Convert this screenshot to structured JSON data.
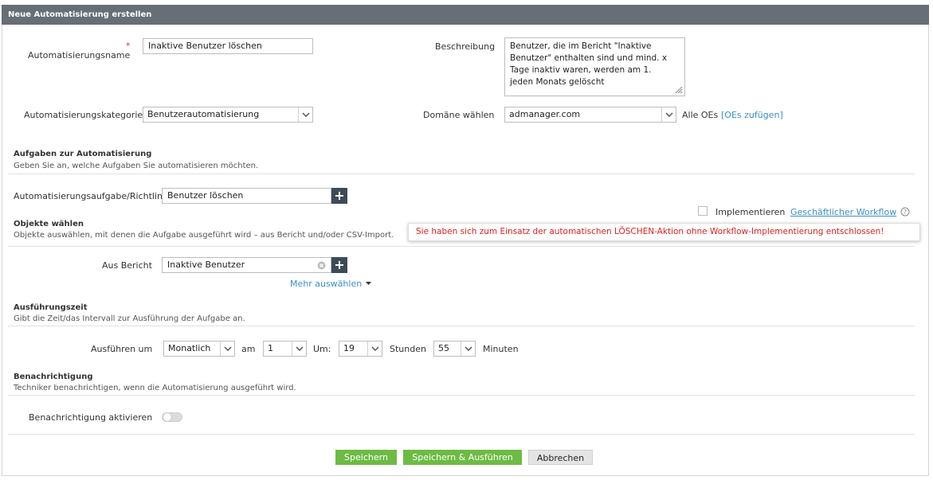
{
  "header": {
    "title": "Neue Automatisierung erstellen"
  },
  "general": {
    "name_label": "Automatisierungsname",
    "required_mark": "*",
    "name_value": "Inaktive Benutzer löschen",
    "description_label": "Beschreibung",
    "description_lines": [
      "Benutzer, die im Bericht \"Inaktive",
      "Benutzer\" enthalten sind und mind. x",
      "Tage inaktiv waren, werden am 1.",
      "jeden Monats gelöscht"
    ],
    "category_label": "Automatisierungskategorie",
    "category_value": "Benutzerautomatisierung",
    "domain_label": "Domäne wählen",
    "domain_value": "admanager.com",
    "all_ous": "Alle OEs",
    "add_ous_link": "[OEs zufügen]"
  },
  "tasks": {
    "title": "Aufgaben zur Automatisierung",
    "desc": "Geben Sie an, welche Aufgaben Sie automatisieren möchten.",
    "task_label": "Automatisierungsaufgabe/Richtlinie",
    "task_value": "Benutzer löschen",
    "implement_label": "Implementieren",
    "workflow_link": "Geschäftlicher Workflow",
    "warning": "Sie haben sich zum Einsatz der automatischen LÖSCHEN-Aktion ohne Workflow-Implementierung entschlossen!"
  },
  "objects": {
    "title": "Objekte wählen",
    "desc": "Objekte auswählen, mit denen die Aufgabe ausgeführt wird – aus Bericht und/oder CSV-Import.",
    "from_report_label": "Aus Bericht",
    "from_report_value": "Inaktive Benutzer",
    "more_select": "Mehr auswählen"
  },
  "schedule": {
    "title": "Ausführungszeit",
    "desc": "Gibt die Zeit/das Intervall zur Ausführung der Aufgabe an.",
    "run_label": "Ausführen um",
    "frequency": "Monatlich",
    "on_label": "am",
    "day": "1",
    "at_label": "Um:",
    "hour": "19",
    "hours_label": "Stunden",
    "minute": "55",
    "minutes_label": "Minuten"
  },
  "notification": {
    "title": "Benachrichtigung",
    "desc": "Techniker benachrichtigen, wenn die Automatisierung ausgeführt wird.",
    "enable_label": "Benachrichtigung aktivieren",
    "enabled": false
  },
  "actions": {
    "save": "Speichern",
    "save_run": "Speichern & Ausführen",
    "cancel": "Abbrechen"
  },
  "colors": {
    "header_bg": "#666e76",
    "primary_green": "#6dbb44",
    "warning_red": "#e02020",
    "link_blue": "#3a8fc6"
  }
}
